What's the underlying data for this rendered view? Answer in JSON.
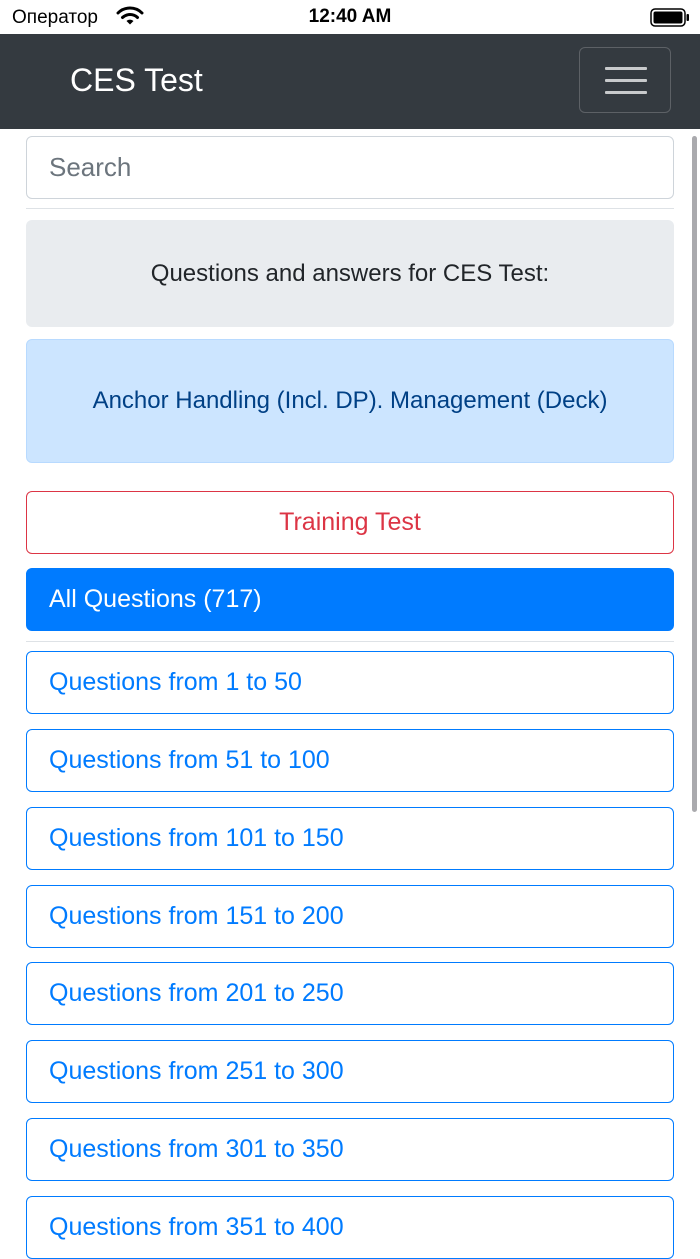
{
  "status_bar": {
    "carrier": "Оператор",
    "time": "12:40 AM"
  },
  "navbar": {
    "brand": "CES Test"
  },
  "search": {
    "placeholder": "Search"
  },
  "info": {
    "heading": "Questions and answers for CES Test:",
    "topic": "Anchor Handling (Incl. DP). Management (Deck)"
  },
  "buttons": {
    "training_test": "Training Test",
    "all_questions": "All Questions (717)"
  },
  "ranges": [
    "Questions from 1 to 50",
    "Questions from 51 to 100",
    "Questions from 101 to 150",
    "Questions from 151 to 200",
    "Questions from 201 to 250",
    "Questions from 251 to 300",
    "Questions from 301 to 350",
    "Questions from 351 to 400"
  ],
  "colors": {
    "navbar_bg": "#343a40",
    "primary": "#007bff",
    "danger": "#dc3545",
    "info_bg": "#e9ecef",
    "topic_bg": "#cce5ff",
    "topic_text": "#004085"
  }
}
